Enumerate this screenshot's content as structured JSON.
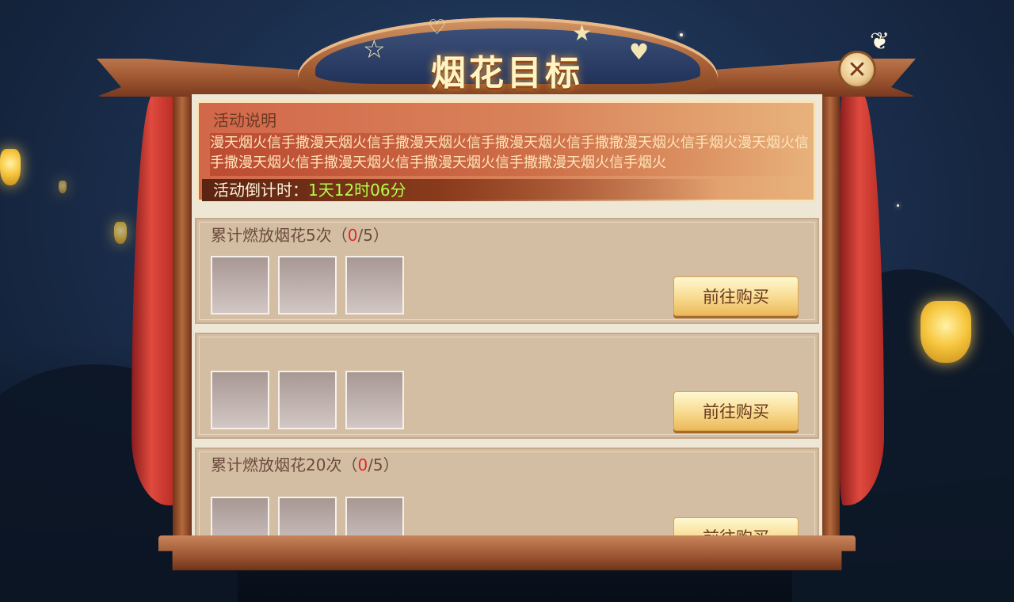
{
  "window": {
    "title": "烟花目标",
    "close_symbol": "✕"
  },
  "description": {
    "heading": "活动说明",
    "text": "漫天烟火信手撒漫天烟火信手撒漫天烟火信手撒漫天烟火信手撒撒漫天烟火信手烟火漫天烟火信手撒漫天烟火信手撒漫天烟火信手撒漫天烟火信手撒撒漫天烟火信手烟火",
    "countdown_label": "活动倒计时：",
    "countdown_value": "1天12时06分"
  },
  "tasks": [
    {
      "title_prefix": "累计燃放烟花5次（",
      "current": "0",
      "title_suffix": "/5）",
      "button_label": "前往购买"
    },
    {
      "title_prefix": "",
      "current": "",
      "title_suffix": "",
      "button_label": "前往购买"
    },
    {
      "title_prefix": "累计燃放烟花20次（",
      "current": "0",
      "title_suffix": "/5）",
      "button_label": "前往购买"
    }
  ],
  "icons": [
    "star-outline-icon",
    "heart-outline-icon",
    "star-filled-icon",
    "heart-filled-icon",
    "close-icon"
  ],
  "colors": {
    "progress_current": "#e0282a",
    "countdown_value": "#b4ff4a",
    "task_bg": "#d4bea3",
    "curtain": "#e04a3e"
  }
}
